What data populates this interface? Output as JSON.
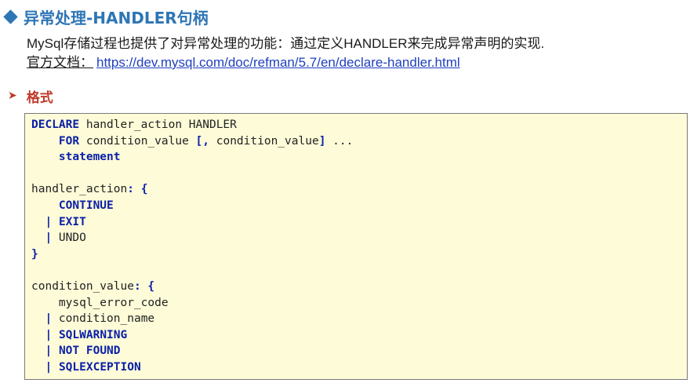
{
  "header": {
    "title": "异常处理-HANDLER句柄",
    "icon": "diamond-icon",
    "accent_color": "#2e75b6"
  },
  "intro": {
    "description": "MySql存储过程也提供了对异常处理的功能：通过定义HANDLER来完成异常声明的实现.",
    "doc_label": "官方文档：",
    "doc_link": "https://dev.mysql.com/doc/refman/5.7/en/declare-handler.html"
  },
  "format": {
    "label": "格式",
    "icon": "arrow-icon",
    "color": "#c0392b"
  },
  "code": {
    "background": "#fdfbd8",
    "keyword_color": "#0a1fa8",
    "lines": [
      [
        {
          "t": "DECLARE",
          "kw": true
        },
        {
          "t": " handler_action HANDLER"
        }
      ],
      [
        {
          "t": "    "
        },
        {
          "t": "FOR",
          "kw": true
        },
        {
          "t": " condition_value "
        },
        {
          "t": "[,",
          "kw": true
        },
        {
          "t": " condition_value"
        },
        {
          "t": "]",
          "kw": true
        },
        {
          "t": " ..."
        }
      ],
      [
        {
          "t": "    "
        },
        {
          "t": "statement",
          "kw": true
        }
      ],
      [
        {
          "t": ""
        }
      ],
      [
        {
          "t": "handler_action"
        },
        {
          "t": ":",
          "kw": true
        },
        {
          "t": " "
        },
        {
          "t": "{",
          "kw": true
        }
      ],
      [
        {
          "t": "    "
        },
        {
          "t": "CONTINUE",
          "kw": true
        }
      ],
      [
        {
          "t": "  "
        },
        {
          "t": "|",
          "kw": true
        },
        {
          "t": " "
        },
        {
          "t": "EXIT",
          "kw": true
        }
      ],
      [
        {
          "t": "  "
        },
        {
          "t": "|",
          "kw": true
        },
        {
          "t": " UNDO"
        }
      ],
      [
        {
          "t": "}",
          "kw": true
        }
      ],
      [
        {
          "t": ""
        }
      ],
      [
        {
          "t": "condition_value"
        },
        {
          "t": ":",
          "kw": true
        },
        {
          "t": " "
        },
        {
          "t": "{",
          "kw": true
        }
      ],
      [
        {
          "t": "    mysql_error_code"
        }
      ],
      [
        {
          "t": "  "
        },
        {
          "t": "|",
          "kw": true
        },
        {
          "t": " condition_name"
        }
      ],
      [
        {
          "t": "  "
        },
        {
          "t": "|",
          "kw": true
        },
        {
          "t": " "
        },
        {
          "t": "SQLWARNING",
          "kw": true
        }
      ],
      [
        {
          "t": "  "
        },
        {
          "t": "|",
          "kw": true
        },
        {
          "t": " "
        },
        {
          "t": "NOT FOUND",
          "kw": true
        }
      ],
      [
        {
          "t": "  "
        },
        {
          "t": "|",
          "kw": true
        },
        {
          "t": " "
        },
        {
          "t": "SQLEXCEPTION",
          "kw": true
        }
      ]
    ]
  }
}
